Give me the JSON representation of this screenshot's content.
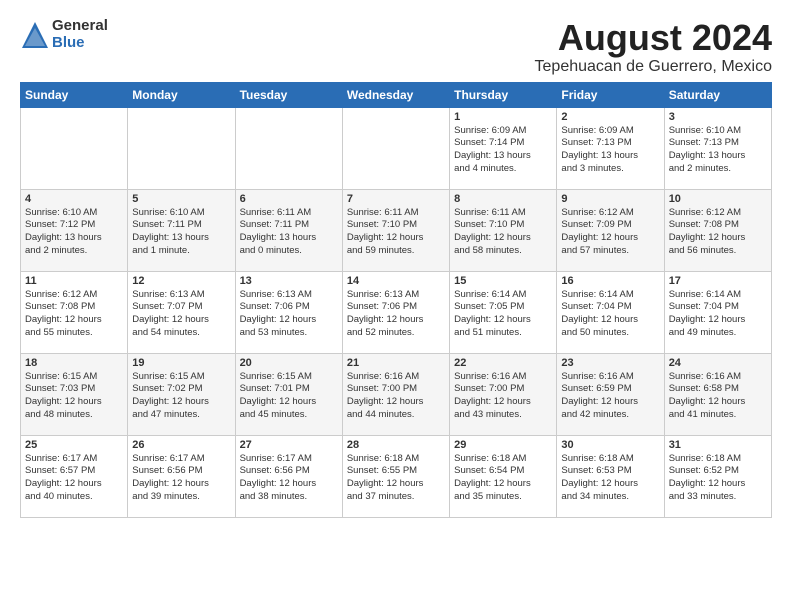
{
  "logo": {
    "general": "General",
    "blue": "Blue"
  },
  "title": "August 2024",
  "location": "Tepehuacan de Guerrero, Mexico",
  "headers": [
    "Sunday",
    "Monday",
    "Tuesday",
    "Wednesday",
    "Thursday",
    "Friday",
    "Saturday"
  ],
  "weeks": [
    [
      {
        "day": "",
        "info": ""
      },
      {
        "day": "",
        "info": ""
      },
      {
        "day": "",
        "info": ""
      },
      {
        "day": "",
        "info": ""
      },
      {
        "day": "1",
        "info": "Sunrise: 6:09 AM\nSunset: 7:14 PM\nDaylight: 13 hours\nand 4 minutes."
      },
      {
        "day": "2",
        "info": "Sunrise: 6:09 AM\nSunset: 7:13 PM\nDaylight: 13 hours\nand 3 minutes."
      },
      {
        "day": "3",
        "info": "Sunrise: 6:10 AM\nSunset: 7:13 PM\nDaylight: 13 hours\nand 2 minutes."
      }
    ],
    [
      {
        "day": "4",
        "info": "Sunrise: 6:10 AM\nSunset: 7:12 PM\nDaylight: 13 hours\nand 2 minutes."
      },
      {
        "day": "5",
        "info": "Sunrise: 6:10 AM\nSunset: 7:11 PM\nDaylight: 13 hours\nand 1 minute."
      },
      {
        "day": "6",
        "info": "Sunrise: 6:11 AM\nSunset: 7:11 PM\nDaylight: 13 hours\nand 0 minutes."
      },
      {
        "day": "7",
        "info": "Sunrise: 6:11 AM\nSunset: 7:10 PM\nDaylight: 12 hours\nand 59 minutes."
      },
      {
        "day": "8",
        "info": "Sunrise: 6:11 AM\nSunset: 7:10 PM\nDaylight: 12 hours\nand 58 minutes."
      },
      {
        "day": "9",
        "info": "Sunrise: 6:12 AM\nSunset: 7:09 PM\nDaylight: 12 hours\nand 57 minutes."
      },
      {
        "day": "10",
        "info": "Sunrise: 6:12 AM\nSunset: 7:08 PM\nDaylight: 12 hours\nand 56 minutes."
      }
    ],
    [
      {
        "day": "11",
        "info": "Sunrise: 6:12 AM\nSunset: 7:08 PM\nDaylight: 12 hours\nand 55 minutes."
      },
      {
        "day": "12",
        "info": "Sunrise: 6:13 AM\nSunset: 7:07 PM\nDaylight: 12 hours\nand 54 minutes."
      },
      {
        "day": "13",
        "info": "Sunrise: 6:13 AM\nSunset: 7:06 PM\nDaylight: 12 hours\nand 53 minutes."
      },
      {
        "day": "14",
        "info": "Sunrise: 6:13 AM\nSunset: 7:06 PM\nDaylight: 12 hours\nand 52 minutes."
      },
      {
        "day": "15",
        "info": "Sunrise: 6:14 AM\nSunset: 7:05 PM\nDaylight: 12 hours\nand 51 minutes."
      },
      {
        "day": "16",
        "info": "Sunrise: 6:14 AM\nSunset: 7:04 PM\nDaylight: 12 hours\nand 50 minutes."
      },
      {
        "day": "17",
        "info": "Sunrise: 6:14 AM\nSunset: 7:04 PM\nDaylight: 12 hours\nand 49 minutes."
      }
    ],
    [
      {
        "day": "18",
        "info": "Sunrise: 6:15 AM\nSunset: 7:03 PM\nDaylight: 12 hours\nand 48 minutes."
      },
      {
        "day": "19",
        "info": "Sunrise: 6:15 AM\nSunset: 7:02 PM\nDaylight: 12 hours\nand 47 minutes."
      },
      {
        "day": "20",
        "info": "Sunrise: 6:15 AM\nSunset: 7:01 PM\nDaylight: 12 hours\nand 45 minutes."
      },
      {
        "day": "21",
        "info": "Sunrise: 6:16 AM\nSunset: 7:00 PM\nDaylight: 12 hours\nand 44 minutes."
      },
      {
        "day": "22",
        "info": "Sunrise: 6:16 AM\nSunset: 7:00 PM\nDaylight: 12 hours\nand 43 minutes."
      },
      {
        "day": "23",
        "info": "Sunrise: 6:16 AM\nSunset: 6:59 PM\nDaylight: 12 hours\nand 42 minutes."
      },
      {
        "day": "24",
        "info": "Sunrise: 6:16 AM\nSunset: 6:58 PM\nDaylight: 12 hours\nand 41 minutes."
      }
    ],
    [
      {
        "day": "25",
        "info": "Sunrise: 6:17 AM\nSunset: 6:57 PM\nDaylight: 12 hours\nand 40 minutes."
      },
      {
        "day": "26",
        "info": "Sunrise: 6:17 AM\nSunset: 6:56 PM\nDaylight: 12 hours\nand 39 minutes."
      },
      {
        "day": "27",
        "info": "Sunrise: 6:17 AM\nSunset: 6:56 PM\nDaylight: 12 hours\nand 38 minutes."
      },
      {
        "day": "28",
        "info": "Sunrise: 6:18 AM\nSunset: 6:55 PM\nDaylight: 12 hours\nand 37 minutes."
      },
      {
        "day": "29",
        "info": "Sunrise: 6:18 AM\nSunset: 6:54 PM\nDaylight: 12 hours\nand 35 minutes."
      },
      {
        "day": "30",
        "info": "Sunrise: 6:18 AM\nSunset: 6:53 PM\nDaylight: 12 hours\nand 34 minutes."
      },
      {
        "day": "31",
        "info": "Sunrise: 6:18 AM\nSunset: 6:52 PM\nDaylight: 12 hours\nand 33 minutes."
      }
    ]
  ]
}
